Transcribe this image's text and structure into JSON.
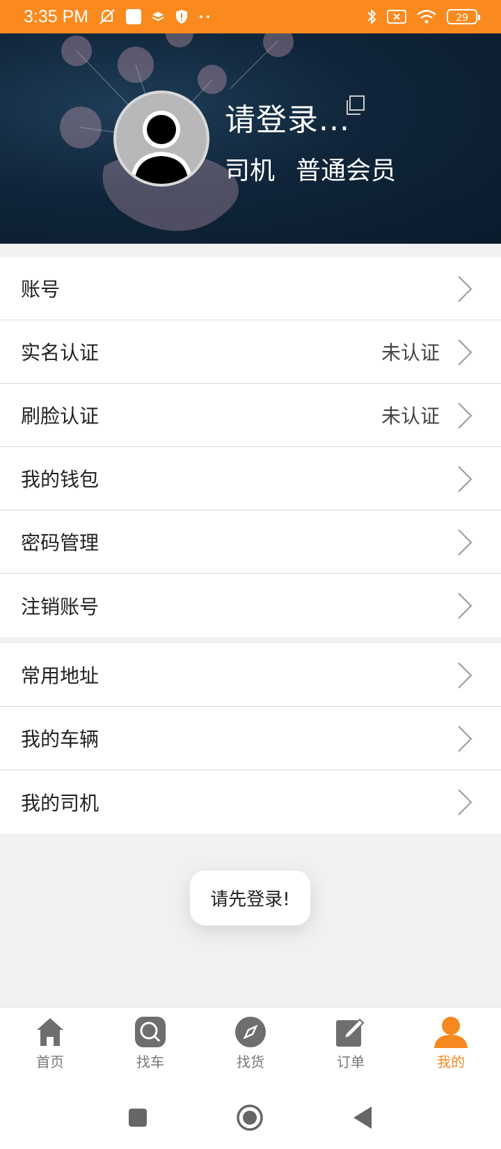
{
  "status_bar": {
    "time": "3:35 PM",
    "battery": "29",
    "icons": [
      "mute-icon",
      "app-icon",
      "layers-icon",
      "shield-icon",
      "more-dots-icon",
      "bluetooth-icon",
      "sim-x-icon",
      "wifi-icon",
      "battery-icon"
    ]
  },
  "header": {
    "user_name": "请登录...",
    "role": "司机",
    "member_level": "普通会员"
  },
  "menu_section_1": [
    {
      "label": "账号",
      "status": ""
    },
    {
      "label": "实名认证",
      "status": "未认证"
    },
    {
      "label": "刷脸认证",
      "status": "未认证"
    },
    {
      "label": "我的钱包",
      "status": ""
    },
    {
      "label": "密码管理",
      "status": ""
    },
    {
      "label": "注销账号",
      "status": ""
    }
  ],
  "menu_section_2": [
    {
      "label": "常用地址",
      "status": ""
    },
    {
      "label": "我的车辆",
      "status": ""
    },
    {
      "label": "我的司机",
      "status": ""
    }
  ],
  "toast": "请先登录!",
  "tabs": [
    {
      "label": "首页",
      "icon": "home-icon"
    },
    {
      "label": "找车",
      "icon": "search-car-icon"
    },
    {
      "label": "找货",
      "icon": "compass-icon"
    },
    {
      "label": "订单",
      "icon": "edit-order-icon"
    },
    {
      "label": "我的",
      "icon": "profile-icon",
      "active": true
    }
  ],
  "colors": {
    "accent": "#f5891f",
    "status_bar": "#fb8a1e",
    "header_bg": "#10253a"
  }
}
